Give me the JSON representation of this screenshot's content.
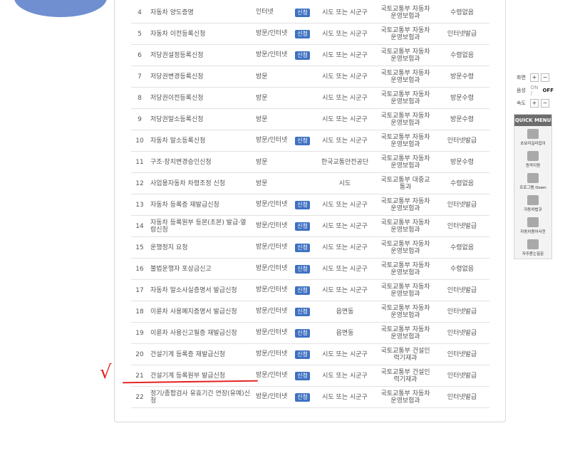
{
  "rows": [
    {
      "num": "4",
      "name": "자동차 양도증명",
      "method": "인터넷",
      "apply": "신청",
      "office": "시도 또는 시군구",
      "dept": "국토교통부 자동차운영보험과",
      "receive": "수령없음"
    },
    {
      "num": "5",
      "name": "자동차 이전등록신청",
      "method": "방문/인터넷",
      "apply": "신청",
      "office": "시도 또는 시군구",
      "dept": "국토교통부 자동차운영보험과",
      "receive": "인터넷발급"
    },
    {
      "num": "6",
      "name": "저당권설정등록신청",
      "method": "방문/인터넷",
      "apply": "신청",
      "office": "시도 또는 시군구",
      "dept": "국토교통부 자동차운영보험과",
      "receive": "수령없음"
    },
    {
      "num": "7",
      "name": "저당권변경등록신청",
      "method": "방문",
      "apply": "",
      "office": "시도 또는 시군구",
      "dept": "국토교통부 자동차운영보험과",
      "receive": "방문수령"
    },
    {
      "num": "8",
      "name": "저당권이전등록신청",
      "method": "방문",
      "apply": "",
      "office": "시도 또는 시군구",
      "dept": "국토교통부 자동차운영보험과",
      "receive": "방문수령"
    },
    {
      "num": "9",
      "name": "저당권말소등록신청",
      "method": "방문",
      "apply": "",
      "office": "시도 또는 시군구",
      "dept": "국토교통부 자동차운영보험과",
      "receive": "방문수령"
    },
    {
      "num": "10",
      "name": "자동차 말소등록신청",
      "method": "방문/인터넷",
      "apply": "신청",
      "office": "시도 또는 시군구",
      "dept": "국토교통부 자동차운영보험과",
      "receive": "인터넷발급"
    },
    {
      "num": "11",
      "name": "구조·장치변경승인신청",
      "method": "방문",
      "apply": "",
      "office": "한국교통안전공단",
      "dept": "국토교통부 자동차운영보험과",
      "receive": "방문수령"
    },
    {
      "num": "12",
      "name": "사업용자동차 차령조정 신청",
      "method": "방문",
      "apply": "",
      "office": "시도",
      "dept": "국토교통부 대중교통과",
      "receive": "수령없음"
    },
    {
      "num": "13",
      "name": "자동차 등록증 재발급신청",
      "method": "방문/인터넷",
      "apply": "신청",
      "office": "시도 또는 시군구",
      "dept": "국토교통부 자동차운영보험과",
      "receive": "인터넷발급"
    },
    {
      "num": "14",
      "name": "자동차 등록원부 등본(초본) 발급·열람신청",
      "method": "방문/인터넷",
      "apply": "신청",
      "office": "시도 또는 시군구",
      "dept": "국토교통부 자동차운영보험과",
      "receive": "인터넷발급"
    },
    {
      "num": "15",
      "name": "운행정지 요청",
      "method": "방문/인터넷",
      "apply": "신청",
      "office": "시도 또는 시군구",
      "dept": "국토교통부 자동차운영보험과",
      "receive": "수령없음"
    },
    {
      "num": "16",
      "name": "불법운행자 포상금신고",
      "method": "방문/인터넷",
      "apply": "신청",
      "office": "시도 또는 시군구",
      "dept": "국토교통부 자동차운영보험과",
      "receive": "수령없음"
    },
    {
      "num": "17",
      "name": "자동차 말소사실증명서 발급신청",
      "method": "방문/인터넷",
      "apply": "신청",
      "office": "시도 또는 시군구",
      "dept": "국토교통부 자동차운영보험과",
      "receive": "인터넷발급"
    },
    {
      "num": "18",
      "name": "이륜차 사용폐지증명서 발급신청",
      "method": "방문/인터넷",
      "apply": "신청",
      "office": "읍면동",
      "dept": "국토교통부 자동차운영보험과",
      "receive": "인터넷발급"
    },
    {
      "num": "19",
      "name": "이륜차 사용신고필증 재발급신청",
      "method": "방문/인터넷",
      "apply": "신청",
      "office": "읍면동",
      "dept": "국토교통부 자동차운영보험과",
      "receive": "인터넷발급"
    },
    {
      "num": "20",
      "name": "건설기계 등록증 재발급신청",
      "method": "방문/인터넷",
      "apply": "신청",
      "office": "시도 또는 시군구",
      "dept": "국토교통부 건설인력기재과",
      "receive": "인터넷발급"
    },
    {
      "num": "21",
      "name": "건설기계 등록원부 발급신청",
      "method": "방문/인터넷",
      "apply": "신청",
      "office": "시도 또는 시군구",
      "dept": "국토교통부 건설인력기재과",
      "receive": "인터넷발급"
    },
    {
      "num": "22",
      "name": "정기/종합검사 유효기간 연장(유예)신청",
      "method": "방문/인터넷",
      "apply": "신청",
      "office": "시도 또는 시군구",
      "dept": "국토교통부 자동차운영보험과",
      "receive": "인터넷발급"
    }
  ],
  "annotation": {
    "check": "√"
  },
  "side": {
    "zoom_label": "화면",
    "plus": "+",
    "minus": "−",
    "sound_label": "음성",
    "sound_on": "ON /",
    "sound_off": "OFF",
    "speed_label": "속도",
    "quick_menu_title": "QUICK MENU",
    "items": [
      {
        "label": "초보자길라잡이",
        "icon": "guide-icon"
      },
      {
        "label": "원격지원",
        "icon": "tools-icon"
      },
      {
        "label": "프로그램 Down",
        "icon": "monitor-icon"
      },
      {
        "label": "자동차법규",
        "icon": "car-icon"
      },
      {
        "label": "자동차용어사전",
        "icon": "dictionary-icon"
      },
      {
        "label": "자주묻는질문",
        "icon": "faq-icon"
      }
    ]
  }
}
